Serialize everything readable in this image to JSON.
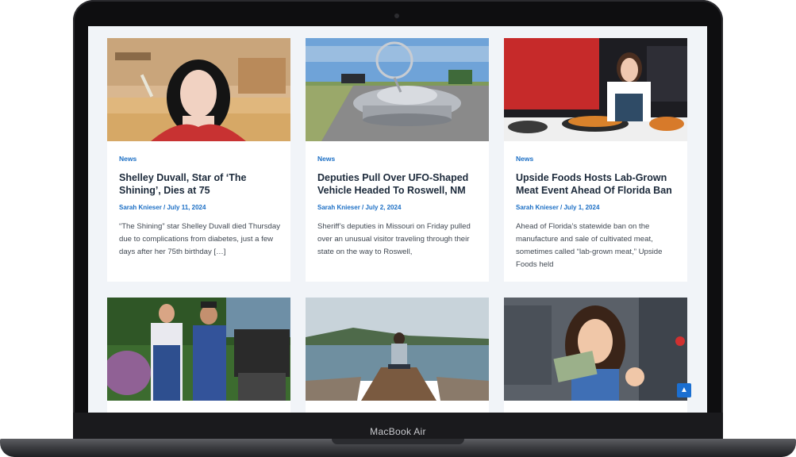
{
  "device": {
    "label": "MacBook Air"
  },
  "articles": [
    {
      "category": "News",
      "title": "Shelley Duvall, Star of ‘The Shining’,  Dies at 75",
      "author": "Sarah Knieser",
      "sep": " / ",
      "date": "July 11, 2024",
      "excerpt": "“The Shining” star Shelley Duvall died Thursday due to complications from diabetes, just a few days after her 75th birthday […]"
    },
    {
      "category": "News",
      "title": "Deputies Pull Over UFO-Shaped Vehicle Headed To Roswell, NM",
      "author": "Sarah Knieser",
      "sep": " / ",
      "date": "July 2, 2024",
      "excerpt": "Sheriff’s deputies in Missouri on Friday pulled over an unusual visitor traveling through their state on the way to Roswell,"
    },
    {
      "category": "News",
      "title": "Upside Foods Hosts Lab-Grown Meat Event Ahead Of Florida Ban",
      "author": "Sarah Knieser",
      "sep": " / ",
      "date": "July 1, 2024",
      "excerpt": "Ahead of Florida’s statewide ban on the manufacture and sale of cultivated meat, sometimes called “lab-grown meat,” Upside Foods held"
    }
  ],
  "scroll_top": {
    "icon": "chevron-up-icon",
    "glyph": "▲"
  },
  "colors": {
    "accent": "#1c6fc5",
    "title": "#1c2a3b",
    "background": "#f1f4f8"
  }
}
